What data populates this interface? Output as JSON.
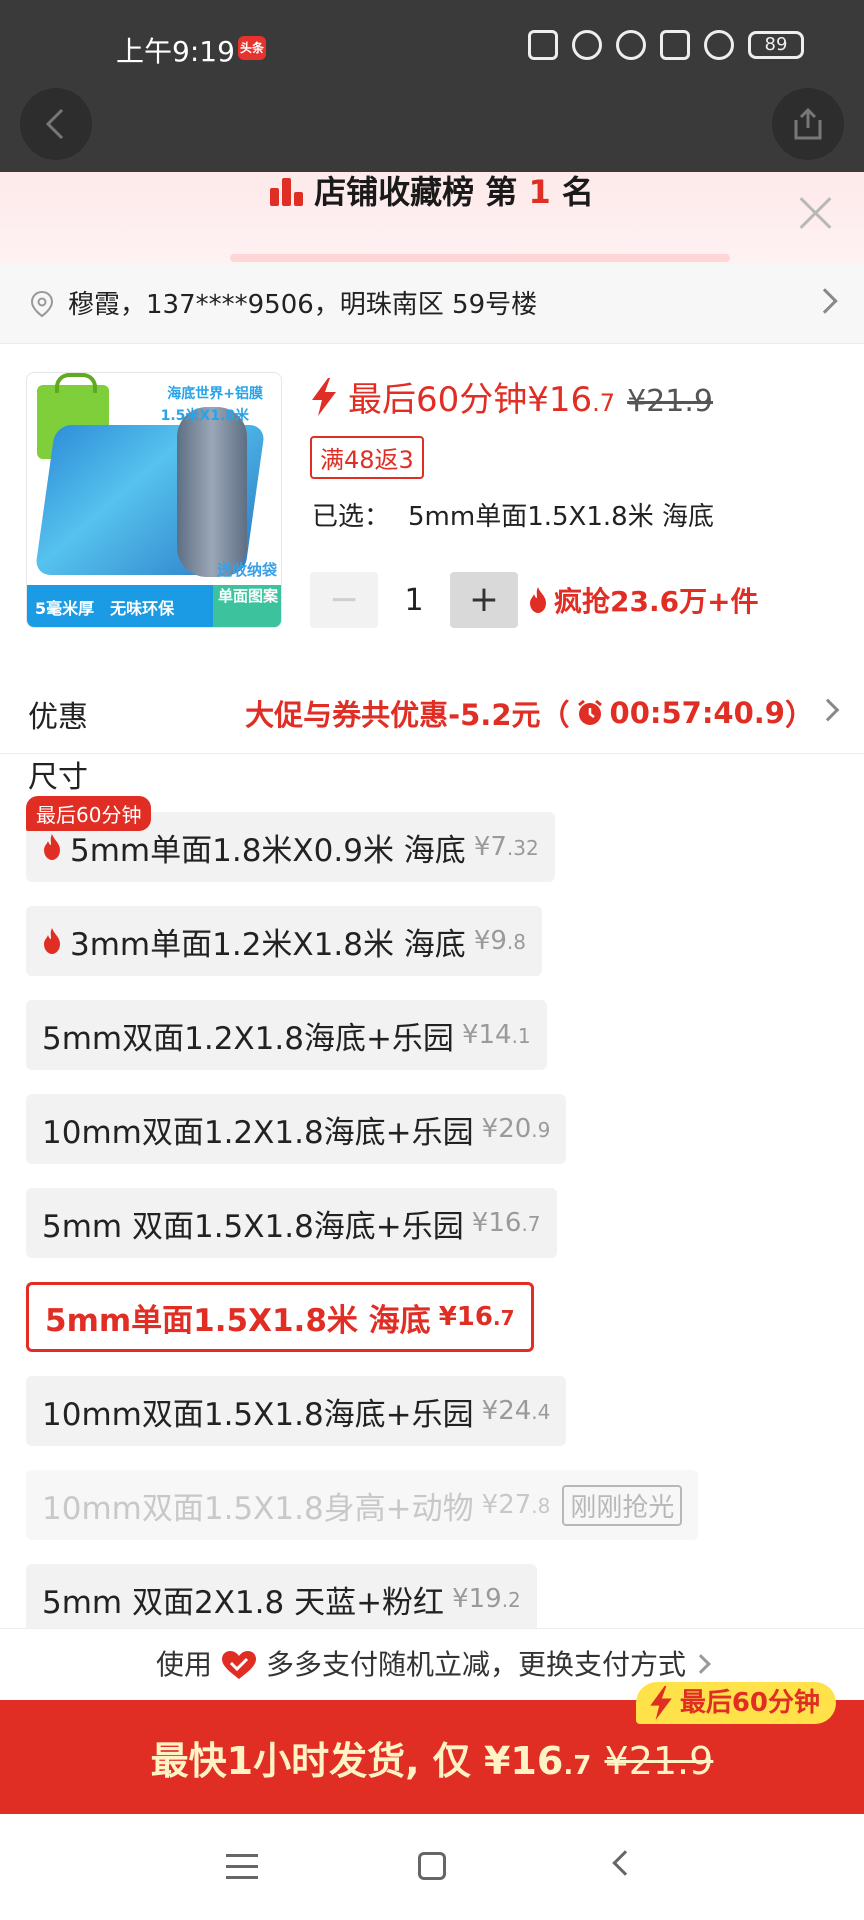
{
  "status_bar": {
    "time": "上午9:19",
    "app_badge": "头条",
    "battery": "89"
  },
  "rank_banner": {
    "text_prefix": "店铺收藏榜 第",
    "rank": "1",
    "text_suffix": "名"
  },
  "address": {
    "text": "穆霞，137****9506，明珠南区 59号楼"
  },
  "product": {
    "thumb_caption1": "海底世界+铝膜",
    "thumb_caption2": "1.5米X1.8米",
    "thumb_bag_tag": "送收纳袋",
    "thumb_footer": "5毫米厚　无味环保",
    "thumb_footer_side": "单面图案",
    "promo_price": "最后60分钟¥16",
    "promo_dec": ".7",
    "original_price": "¥21.9",
    "coupon": "满48返3",
    "selected_label": "已选：",
    "selected_value": "5mm单面1.5X1.8米 海底",
    "quantity": "1",
    "sold": "疯抢23.6万+件"
  },
  "discount": {
    "label": "优惠",
    "value_prefix": "大促与券共优惠-5.2元（",
    "countdown": "00:57:40.9",
    "value_suffix": "）"
  },
  "size_section": {
    "title": "尺寸",
    "first_badge": "最后60分钟"
  },
  "options": [
    {
      "label": "5mm单面1.8米X0.9米  海底",
      "price": "¥7",
      "dec": ".32",
      "hot": true,
      "state": "normal"
    },
    {
      "label": "3mm单面1.2米X1.8米 海底",
      "price": "¥9",
      "dec": ".8",
      "hot": true,
      "state": "normal"
    },
    {
      "label": "5mm双面1.2X1.8海底+乐园",
      "price": "¥14",
      "dec": ".1",
      "hot": false,
      "state": "normal"
    },
    {
      "label": "10mm双面1.2X1.8海底+乐园",
      "price": "¥20",
      "dec": ".9",
      "hot": false,
      "state": "normal"
    },
    {
      "label": "5mm 双面1.5X1.8海底+乐园",
      "price": "¥16",
      "dec": ".7",
      "hot": false,
      "state": "normal"
    },
    {
      "label": "5mm单面1.5X1.8米 海底",
      "price": "¥16",
      "dec": ".7",
      "hot": false,
      "state": "selected"
    },
    {
      "label": "10mm双面1.5X1.8海底+乐园",
      "price": "¥24",
      "dec": ".4",
      "hot": false,
      "state": "normal"
    },
    {
      "label": "10mm双面1.5X1.8身高+动物",
      "price": "¥27",
      "dec": ".8",
      "hot": false,
      "state": "disabled",
      "soldout": "刚刚抢光"
    },
    {
      "label": "5mm 双面2X1.8 天蓝+粉红",
      "price": "¥19",
      "dec": ".2",
      "hot": false,
      "state": "normal"
    }
  ],
  "payment": {
    "prefix": "使用",
    "text": "多多支付随机立减，更换支付方式"
  },
  "buy_bar": {
    "badge": "最后60分钟",
    "main": "最快1小时发货, 仅 ¥16",
    "dec": ".7",
    "orig": "¥21.9"
  },
  "colors": {
    "accent": "#e02e24",
    "badge_yellow": "#ffe14a",
    "cream_text": "#fff3c6"
  }
}
